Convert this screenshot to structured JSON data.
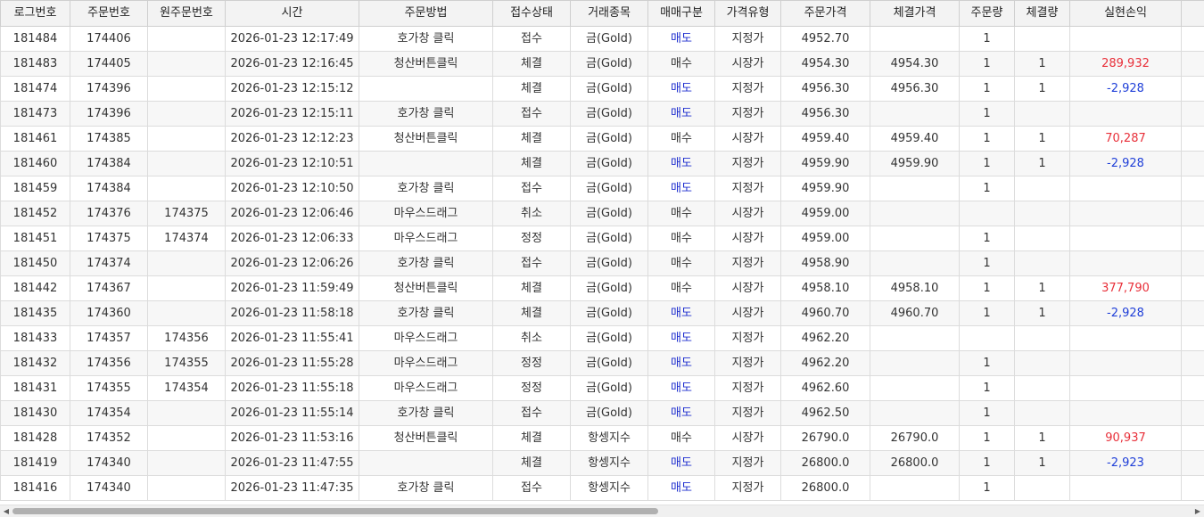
{
  "columns": [
    "로그번호",
    "주문번호",
    "원주문번호",
    "시간",
    "주문방법",
    "접수상태",
    "거래종목",
    "매매구분",
    "가격유형",
    "주문가격",
    "체결가격",
    "주문량",
    "체결량",
    "실현손익"
  ],
  "rows": [
    {
      "log": "181484",
      "order": "174406",
      "orig": "",
      "time": "2026-01-23 12:17:49",
      "method": "호가창 클릭",
      "status": "접수",
      "symbol": "금(Gold)",
      "side": "매도",
      "ptype": "지정가",
      "oprice": "4952.70",
      "fprice": "",
      "oqty": "1",
      "fqty": "",
      "pnl": ""
    },
    {
      "log": "181483",
      "order": "174405",
      "orig": "",
      "time": "2026-01-23 12:16:45",
      "method": "청산버튼클릭",
      "status": "체결",
      "symbol": "금(Gold)",
      "side": "매수",
      "ptype": "시장가",
      "oprice": "4954.30",
      "fprice": "4954.30",
      "oqty": "1",
      "fqty": "1",
      "pnl": "289,932"
    },
    {
      "log": "181474",
      "order": "174396",
      "orig": "",
      "time": "2026-01-23 12:15:12",
      "method": "",
      "status": "체결",
      "symbol": "금(Gold)",
      "side": "매도",
      "ptype": "지정가",
      "oprice": "4956.30",
      "fprice": "4956.30",
      "oqty": "1",
      "fqty": "1",
      "pnl": "-2,928"
    },
    {
      "log": "181473",
      "order": "174396",
      "orig": "",
      "time": "2026-01-23 12:15:11",
      "method": "호가창 클릭",
      "status": "접수",
      "symbol": "금(Gold)",
      "side": "매도",
      "ptype": "지정가",
      "oprice": "4956.30",
      "fprice": "",
      "oqty": "1",
      "fqty": "",
      "pnl": ""
    },
    {
      "log": "181461",
      "order": "174385",
      "orig": "",
      "time": "2026-01-23 12:12:23",
      "method": "청산버튼클릭",
      "status": "체결",
      "symbol": "금(Gold)",
      "side": "매수",
      "ptype": "시장가",
      "oprice": "4959.40",
      "fprice": "4959.40",
      "oqty": "1",
      "fqty": "1",
      "pnl": "70,287"
    },
    {
      "log": "181460",
      "order": "174384",
      "orig": "",
      "time": "2026-01-23 12:10:51",
      "method": "",
      "status": "체결",
      "symbol": "금(Gold)",
      "side": "매도",
      "ptype": "지정가",
      "oprice": "4959.90",
      "fprice": "4959.90",
      "oqty": "1",
      "fqty": "1",
      "pnl": "-2,928"
    },
    {
      "log": "181459",
      "order": "174384",
      "orig": "",
      "time": "2026-01-23 12:10:50",
      "method": "호가창 클릭",
      "status": "접수",
      "symbol": "금(Gold)",
      "side": "매도",
      "ptype": "지정가",
      "oprice": "4959.90",
      "fprice": "",
      "oqty": "1",
      "fqty": "",
      "pnl": ""
    },
    {
      "log": "181452",
      "order": "174376",
      "orig": "174375",
      "time": "2026-01-23 12:06:46",
      "method": "마우스드래그",
      "status": "취소",
      "symbol": "금(Gold)",
      "side": "매수",
      "ptype": "시장가",
      "oprice": "4959.00",
      "fprice": "",
      "oqty": "",
      "fqty": "",
      "pnl": ""
    },
    {
      "log": "181451",
      "order": "174375",
      "orig": "174374",
      "time": "2026-01-23 12:06:33",
      "method": "마우스드래그",
      "status": "정정",
      "symbol": "금(Gold)",
      "side": "매수",
      "ptype": "시장가",
      "oprice": "4959.00",
      "fprice": "",
      "oqty": "1",
      "fqty": "",
      "pnl": ""
    },
    {
      "log": "181450",
      "order": "174374",
      "orig": "",
      "time": "2026-01-23 12:06:26",
      "method": "호가창 클릭",
      "status": "접수",
      "symbol": "금(Gold)",
      "side": "매수",
      "ptype": "지정가",
      "oprice": "4958.90",
      "fprice": "",
      "oqty": "1",
      "fqty": "",
      "pnl": ""
    },
    {
      "log": "181442",
      "order": "174367",
      "orig": "",
      "time": "2026-01-23 11:59:49",
      "method": "청산버튼클릭",
      "status": "체결",
      "symbol": "금(Gold)",
      "side": "매수",
      "ptype": "시장가",
      "oprice": "4958.10",
      "fprice": "4958.10",
      "oqty": "1",
      "fqty": "1",
      "pnl": "377,790"
    },
    {
      "log": "181435",
      "order": "174360",
      "orig": "",
      "time": "2026-01-23 11:58:18",
      "method": "호가창 클릭",
      "status": "체결",
      "symbol": "금(Gold)",
      "side": "매도",
      "ptype": "시장가",
      "oprice": "4960.70",
      "fprice": "4960.70",
      "oqty": "1",
      "fqty": "1",
      "pnl": "-2,928"
    },
    {
      "log": "181433",
      "order": "174357",
      "orig": "174356",
      "time": "2026-01-23 11:55:41",
      "method": "마우스드래그",
      "status": "취소",
      "symbol": "금(Gold)",
      "side": "매도",
      "ptype": "지정가",
      "oprice": "4962.20",
      "fprice": "",
      "oqty": "",
      "fqty": "",
      "pnl": ""
    },
    {
      "log": "181432",
      "order": "174356",
      "orig": "174355",
      "time": "2026-01-23 11:55:28",
      "method": "마우스드래그",
      "status": "정정",
      "symbol": "금(Gold)",
      "side": "매도",
      "ptype": "지정가",
      "oprice": "4962.20",
      "fprice": "",
      "oqty": "1",
      "fqty": "",
      "pnl": ""
    },
    {
      "log": "181431",
      "order": "174355",
      "orig": "174354",
      "time": "2026-01-23 11:55:18",
      "method": "마우스드래그",
      "status": "정정",
      "symbol": "금(Gold)",
      "side": "매도",
      "ptype": "지정가",
      "oprice": "4962.60",
      "fprice": "",
      "oqty": "1",
      "fqty": "",
      "pnl": ""
    },
    {
      "log": "181430",
      "order": "174354",
      "orig": "",
      "time": "2026-01-23 11:55:14",
      "method": "호가창 클릭",
      "status": "접수",
      "symbol": "금(Gold)",
      "side": "매도",
      "ptype": "지정가",
      "oprice": "4962.50",
      "fprice": "",
      "oqty": "1",
      "fqty": "",
      "pnl": ""
    },
    {
      "log": "181428",
      "order": "174352",
      "orig": "",
      "time": "2026-01-23 11:53:16",
      "method": "청산버튼클릭",
      "status": "체결",
      "symbol": "항셍지수",
      "side": "매수",
      "ptype": "시장가",
      "oprice": "26790.0",
      "fprice": "26790.0",
      "oqty": "1",
      "fqty": "1",
      "pnl": "90,937"
    },
    {
      "log": "181419",
      "order": "174340",
      "orig": "",
      "time": "2026-01-23 11:47:55",
      "method": "",
      "status": "체결",
      "symbol": "항셍지수",
      "side": "매도",
      "ptype": "지정가",
      "oprice": "26800.0",
      "fprice": "26800.0",
      "oqty": "1",
      "fqty": "1",
      "pnl": "-2,923"
    },
    {
      "log": "181416",
      "order": "174340",
      "orig": "",
      "time": "2026-01-23 11:47:35",
      "method": "호가창 클릭",
      "status": "접수",
      "symbol": "항셍지수",
      "side": "매도",
      "ptype": "지정가",
      "oprice": "26800.0",
      "fprice": "",
      "oqty": "1",
      "fqty": "",
      "pnl": ""
    }
  ],
  "colors": {
    "profit": "#e8303a",
    "loss": "#1f3fd8",
    "sell": "#1f2fcf"
  },
  "scrollbar": {
    "left_icon": "triangle-left-icon",
    "right_icon": "triangle-right-icon"
  }
}
